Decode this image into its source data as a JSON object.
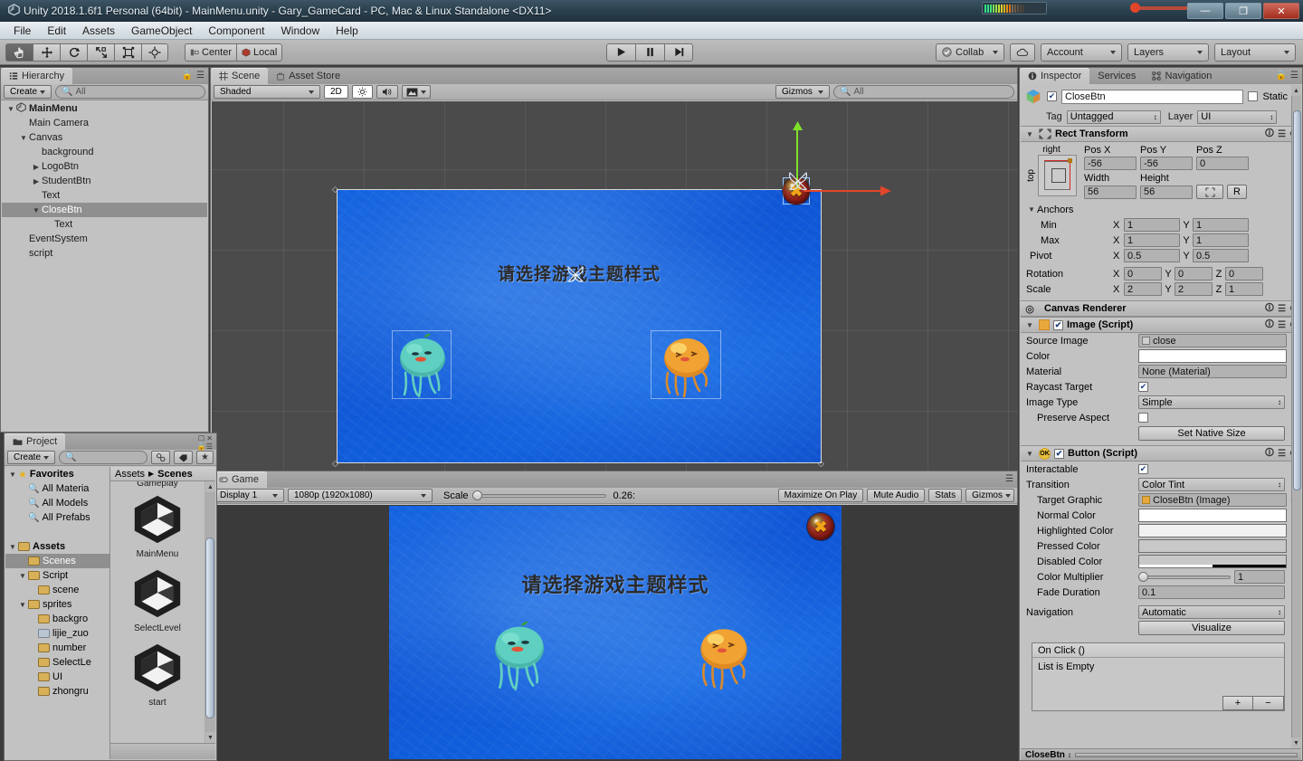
{
  "titlebar": {
    "title": "Unity 2018.1.6f1 Personal (64bit) - MainMenu.unity - Gary_GameCard - PC, Mac & Linux Standalone <DX11>",
    "app_icon": "unity-icon",
    "minimize": "—",
    "maximize": "❐",
    "close": "✕"
  },
  "menubar": {
    "items": [
      "File",
      "Edit",
      "Assets",
      "GameObject",
      "Component",
      "Window",
      "Help"
    ]
  },
  "toolbar": {
    "tools": [
      {
        "name": "hand-tool",
        "icon": "hand-icon",
        "active": true
      },
      {
        "name": "move-tool",
        "icon": "move-icon",
        "active": false
      },
      {
        "name": "rotate-tool",
        "icon": "rotate-icon",
        "active": false
      },
      {
        "name": "scale-tool",
        "icon": "scale-icon",
        "active": false
      },
      {
        "name": "rect-tool",
        "icon": "rect-icon",
        "active": false
      },
      {
        "name": "transform-tool",
        "icon": "transform-icon",
        "active": false
      }
    ],
    "pivot_mode": "Center",
    "pivot_rotation": "Local",
    "play": "▶",
    "pause": "‖",
    "step": "▶|",
    "collab": "Collab",
    "cloud": "cloud-icon",
    "account": "Account",
    "layers": "Layers",
    "layout": "Layout"
  },
  "hierarchy": {
    "tab": "Hierarchy",
    "create": "Create",
    "search_placeholder": "All",
    "items": [
      {
        "label": "MainMenu",
        "depth": 0,
        "arrow": "down",
        "icon": "scene-icon",
        "selected": false,
        "bold": true
      },
      {
        "label": "Main Camera",
        "depth": 1,
        "arrow": "none",
        "selected": false
      },
      {
        "label": "Canvas",
        "depth": 1,
        "arrow": "down",
        "selected": false
      },
      {
        "label": "background",
        "depth": 2,
        "arrow": "none",
        "selected": false
      },
      {
        "label": "LogoBtn",
        "depth": 2,
        "arrow": "right",
        "selected": false
      },
      {
        "label": "StudentBtn",
        "depth": 2,
        "arrow": "right",
        "selected": false
      },
      {
        "label": "Text",
        "depth": 2,
        "arrow": "none",
        "selected": false
      },
      {
        "label": "CloseBtn",
        "depth": 2,
        "arrow": "down",
        "selected": true
      },
      {
        "label": "Text",
        "depth": 3,
        "arrow": "none",
        "selected": false
      },
      {
        "label": "EventSystem",
        "depth": 1,
        "arrow": "none",
        "selected": false
      },
      {
        "label": "script",
        "depth": 1,
        "arrow": "none",
        "selected": false
      }
    ]
  },
  "scene": {
    "tabs": [
      {
        "label": "Scene",
        "icon": "grid-icon",
        "selected": true
      },
      {
        "label": "Asset Store",
        "icon": "store-icon",
        "selected": false
      }
    ],
    "draw_mode": "Shaded",
    "twod": "2D",
    "lighting_icon": "sun-icon",
    "audio_icon": "speaker-icon",
    "fx_icon": "image-icon",
    "gizmos": "Gizmos",
    "search_placeholder": "All"
  },
  "game_canvas": {
    "title_text": "请选择游戏主题样式",
    "close_icon": "close-circle-icon",
    "jelly_left": "green-jellyfish",
    "jelly_right": "orange-jellyfish",
    "bg_color": "#1160dd"
  },
  "game": {
    "tab": "Game",
    "display": "Display 1",
    "resolution": "1080p (1920x1080)",
    "scale_label": "Scale",
    "scale_value": "0.26:",
    "maximize_on_play": "Maximize On Play",
    "mute_audio": "Mute Audio",
    "stats": "Stats",
    "gizmos": "Gizmos"
  },
  "project": {
    "tab": "Project",
    "create": "Create",
    "search_placeholder": "",
    "breadcrumb": [
      "Assets",
      "Scenes"
    ],
    "tree": [
      {
        "label": "Favorites",
        "depth": 0,
        "arrow": "down",
        "icon": "star",
        "bold": true
      },
      {
        "label": "All Materia",
        "depth": 1,
        "arrow": "none",
        "icon": "search"
      },
      {
        "label": "All Models",
        "depth": 1,
        "arrow": "none",
        "icon": "search"
      },
      {
        "label": "All Prefabs",
        "depth": 1,
        "arrow": "none",
        "icon": "search"
      },
      {
        "label": "",
        "depth": 0,
        "arrow": "none",
        "icon": "none"
      },
      {
        "label": "Assets",
        "depth": 0,
        "arrow": "down",
        "icon": "folder",
        "bold": true
      },
      {
        "label": "Scenes",
        "depth": 1,
        "arrow": "none",
        "icon": "folder",
        "selected": true
      },
      {
        "label": "Script",
        "depth": 1,
        "arrow": "down",
        "icon": "folder"
      },
      {
        "label": "scene",
        "depth": 2,
        "arrow": "none",
        "icon": "folder"
      },
      {
        "label": "sprites",
        "depth": 1,
        "arrow": "down",
        "icon": "folder"
      },
      {
        "label": "backgro",
        "depth": 2,
        "arrow": "none",
        "icon": "folder"
      },
      {
        "label": "lijie_zuo",
        "depth": 2,
        "arrow": "none",
        "icon": "folder-blue"
      },
      {
        "label": "number",
        "depth": 2,
        "arrow": "none",
        "icon": "folder"
      },
      {
        "label": "SelectLe",
        "depth": 2,
        "arrow": "none",
        "icon": "folder"
      },
      {
        "label": "UI",
        "depth": 2,
        "arrow": "none",
        "icon": "folder"
      },
      {
        "label": "zhongru",
        "depth": 2,
        "arrow": "none",
        "icon": "folder"
      }
    ],
    "assets": [
      {
        "label": "Gameplay",
        "icon": "unity-scene-icon",
        "clipped": true
      },
      {
        "label": "MainMenu",
        "icon": "unity-scene-icon"
      },
      {
        "label": "SelectLevel",
        "icon": "unity-scene-icon"
      },
      {
        "label": "start",
        "icon": "unity-scene-icon"
      }
    ]
  },
  "inspector": {
    "tabs": [
      {
        "label": "Inspector",
        "icon": "info-icon",
        "selected": true
      },
      {
        "label": "Services",
        "icon": "",
        "selected": false
      },
      {
        "label": "Navigation",
        "icon": "nav-icon",
        "selected": false
      }
    ],
    "object_name": "CloseBtn",
    "object_enabled": true,
    "static_label": "Static",
    "tag_label": "Tag",
    "tag_value": "Untagged",
    "layer_label": "Layer",
    "layer_value": "UI",
    "rect_transform": {
      "title": "Rect Transform",
      "anchor_preset_top": "top",
      "anchor_preset_right": "right",
      "headers": [
        "Pos X",
        "Pos Y",
        "Pos Z"
      ],
      "pos": [
        "-56",
        "-56",
        "0"
      ],
      "size_headers": [
        "Width",
        "Height"
      ],
      "size": [
        "56",
        "56"
      ],
      "blueprint_btn": "blueprint-icon",
      "raw_btn": "R",
      "anchors_label": "Anchors",
      "min_label": "Min",
      "min": {
        "x": "1",
        "y": "1"
      },
      "max_label": "Max",
      "max": {
        "x": "1",
        "y": "1"
      },
      "pivot_label": "Pivot",
      "pivot": {
        "x": "0.5",
        "y": "0.5"
      },
      "rotation_label": "Rotation",
      "rotation": {
        "x": "0",
        "y": "0",
        "z": "0"
      },
      "scale_label": "Scale",
      "scale": {
        "x": "2",
        "y": "2",
        "z": "1"
      }
    },
    "canvas_renderer": {
      "title": "Canvas Renderer"
    },
    "image_script": {
      "title": "Image (Script)",
      "enabled": true,
      "rows": [
        {
          "label": "Source Image",
          "value": "close",
          "type": "object"
        },
        {
          "label": "Color",
          "value": "",
          "type": "color",
          "color": "#ffffff"
        },
        {
          "label": "Material",
          "value": "None (Material)",
          "type": "object"
        },
        {
          "label": "Raycast Target",
          "value": "",
          "type": "checkbox",
          "checked": true
        },
        {
          "label": "Image Type",
          "value": "Simple",
          "type": "dropdown"
        },
        {
          "label": "Preserve Aspect",
          "value": "",
          "type": "checkbox",
          "checked": false
        }
      ],
      "native_size_btn": "Set Native Size"
    },
    "button_script": {
      "title": "Button (Script)",
      "enabled": true,
      "interactable_label": "Interactable",
      "interactable": true,
      "transition_label": "Transition",
      "transition_value": "Color Tint",
      "target_graphic_label": "Target Graphic",
      "target_graphic_value": "CloseBtn (Image)",
      "colors": [
        {
          "label": "Normal Color",
          "color": "#ffffff"
        },
        {
          "label": "Highlighted Color",
          "color": "#f2f2f2"
        },
        {
          "label": "Pressed Color",
          "color": "#c8c8c8"
        },
        {
          "label": "Disabled Color",
          "color": "#c8c8c8",
          "alpha": 0.5
        }
      ],
      "color_multiplier_label": "Color Multiplier",
      "color_multiplier": "1",
      "fade_duration_label": "Fade Duration",
      "fade_duration": "0.1",
      "navigation_label": "Navigation",
      "navigation_value": "Automatic",
      "visualize_btn": "Visualize",
      "onclick_label": "On Click ()",
      "onclick_empty": "List is Empty",
      "add_btn": "+",
      "remove_btn": "−"
    },
    "footer_label": "CloseBtn"
  }
}
